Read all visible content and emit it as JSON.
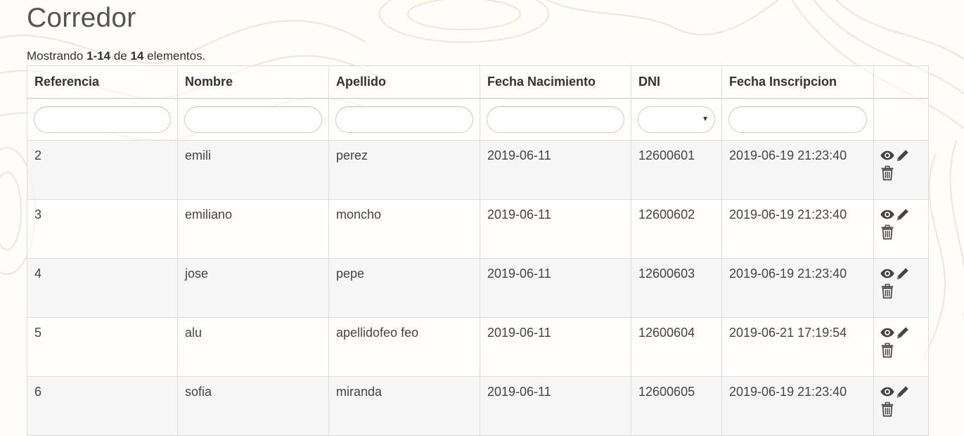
{
  "page": {
    "title": "Corredor",
    "summary_prefix": "Mostrando",
    "summary_range": "1-14",
    "summary_mid": "de",
    "summary_total": "14",
    "summary_suffix": "elementos."
  },
  "table": {
    "columns": [
      "Referencia",
      "Nombre",
      "Apellido",
      "Fecha Nacimiento",
      "DNI",
      "Fecha Inscripcion"
    ],
    "rows": [
      {
        "ref": "2",
        "nombre": "emili",
        "apellido": "perez",
        "fecha_nac": "2019-06-11",
        "dni": "12600601",
        "fecha_ins": "2019-06-19 21:23:40"
      },
      {
        "ref": "3",
        "nombre": "emiliano",
        "apellido": "moncho",
        "fecha_nac": "2019-06-11",
        "dni": "12600602",
        "fecha_ins": "2019-06-19 21:23:40"
      },
      {
        "ref": "4",
        "nombre": "jose",
        "apellido": "pepe",
        "fecha_nac": "2019-06-11",
        "dni": "12600603",
        "fecha_ins": "2019-06-19 21:23:40"
      },
      {
        "ref": "5",
        "nombre": "alu",
        "apellido": "apellidofeo feo",
        "fecha_nac": "2019-06-11",
        "dni": "12600604",
        "fecha_ins": "2019-06-21 17:19:54"
      },
      {
        "ref": "6",
        "nombre": "sofia",
        "apellido": "miranda",
        "fecha_nac": "2019-06-11",
        "dni": "12600605",
        "fecha_ins": "2019-06-19 21:23:40"
      }
    ],
    "actions": [
      "eye-icon",
      "pencil-icon",
      "trash-icon"
    ]
  },
  "colors": {
    "text": "#333333",
    "border": "#dddddd",
    "row_stripe": "#f5f5f5",
    "icon": "#444444"
  }
}
